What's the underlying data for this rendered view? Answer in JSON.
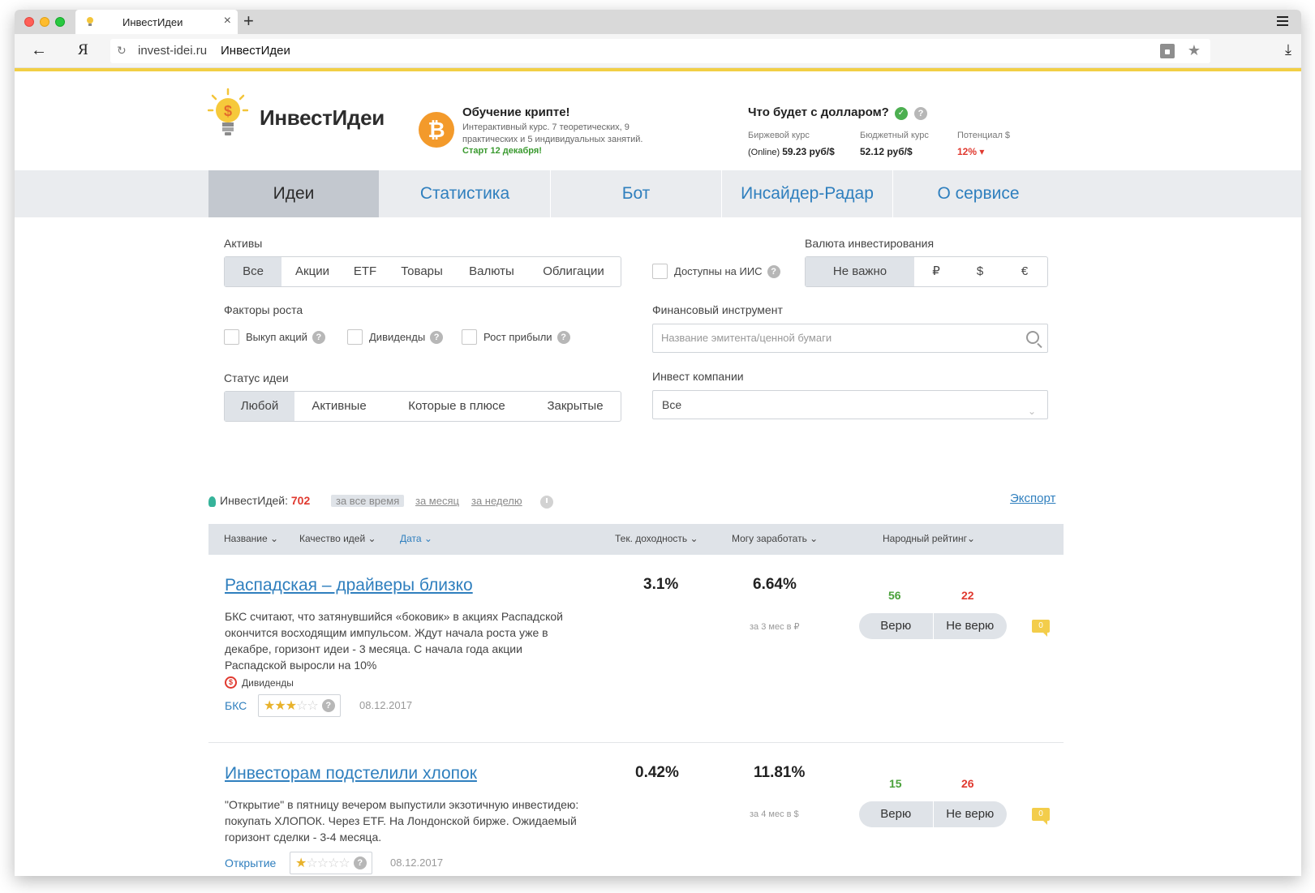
{
  "browser": {
    "tab_title": "ИнвестИдеи",
    "tab_close": "×",
    "new_tab": "+",
    "back": "←",
    "yandex": "Я",
    "reload": "↻",
    "url_domain": "invest-idei.ru",
    "url_title": "ИнвестИдеи",
    "star": "★",
    "download": "⤓"
  },
  "header": {
    "logo": "ИнвестИдеи",
    "btc_symbol": "₿",
    "promo_title": "Обучение крипте!",
    "promo_desc": "Интерактивный курс. 7 теоретических, 9 практических и 5 индивидуальных занятий.",
    "promo_start": "Старт 12 декабря!",
    "usd_title": "Что будет с долларом?",
    "rates": {
      "exchange_label": "Биржевой курс",
      "exchange_prefix": "(Online)",
      "exchange_value": "59.23 руб/$",
      "budget_label": "Бюджетный курс",
      "budget_value": "52.12 руб/$",
      "potential_label": "Потенциал $",
      "potential_value": "12% ▾"
    }
  },
  "nav": [
    "Идеи",
    "Статистика",
    "Бот",
    "Инсайдер-Радар",
    "О сервисе"
  ],
  "filters": {
    "assets_label": "Активы",
    "assets": [
      "Все",
      "Акции",
      "ETF",
      "Товары",
      "Валюты",
      "Облигации"
    ],
    "iis_label": "Доступны на ИИС",
    "currency_label": "Валюта инвестирования",
    "currencies": [
      "Не важно",
      "₽",
      "$",
      "€"
    ],
    "growth_label": "Факторы роста",
    "growth": [
      "Выкуп акций",
      "Дивиденды",
      "Рост прибыли"
    ],
    "instrument_label": "Финансовый инструмент",
    "instrument_placeholder": "Название эмитента/ценной бумаги",
    "status_label": "Статус идеи",
    "statuses": [
      "Любой",
      "Активные",
      "Которые в плюсе",
      "Закрытые"
    ],
    "companies_label": "Инвест компании",
    "companies_value": "Все"
  },
  "counter": {
    "label": "ИнвестИдей:",
    "value": "702",
    "periods": [
      "за все время",
      "за месяц",
      "за неделю"
    ],
    "export": "Экспорт"
  },
  "table_header": {
    "name": "Название ⌄",
    "quality": "Качество идей ⌄",
    "date": "Дата ⌄",
    "yield": "Тек. доходность ⌄",
    "potential": "Могу заработать ⌄",
    "rating": "Народный рейтинг⌄"
  },
  "ideas": [
    {
      "title": "Распадская – драйверы близко",
      "desc": "БКС считают, что затянувшийся «боковик» в акциях Распадской окончится восходящим импульсом. Ждут начала роста уже в декабре, горизонт идеи - 3 месяца. С начала года акции Распадской выросли на 10%",
      "tag": "Дивиденды",
      "broker": "БКС",
      "stars": "★★★",
      "stars_off": "☆☆",
      "date": "08.12.2017",
      "yield": "3.1%",
      "potential": "6.64%",
      "potential_note": "за 3 мес в ₽",
      "believe": "56",
      "disbelieve": "22",
      "comments": "0"
    },
    {
      "title": "Инвесторам подстелили хлопок",
      "desc": "\"Открытие\" в пятницу вечером выпустили экзотичную инвестидею: покупать ХЛОПОК. Через ETF. На Лондонской бирже. Ожидаемый горизонт сделки - 3-4 месяца.",
      "broker": "Открытие",
      "stars": "★",
      "stars_off": "☆☆☆☆",
      "date": "08.12.2017",
      "yield": "0.42%",
      "potential": "11.81%",
      "potential_note": "за 4 мес в $",
      "believe": "15",
      "disbelieve": "26",
      "comments": "0"
    }
  ],
  "vote": {
    "believe_label": "Верю",
    "disbelieve_label": "Не верю"
  },
  "icons": {
    "help": "?",
    "dividend": "$",
    "check": "✓",
    "chevron": "⌄"
  },
  "colors": {
    "accent": "#f2cf45",
    "link": "#2f7fbe",
    "red": "#e0392f",
    "green": "#4aa13a"
  }
}
